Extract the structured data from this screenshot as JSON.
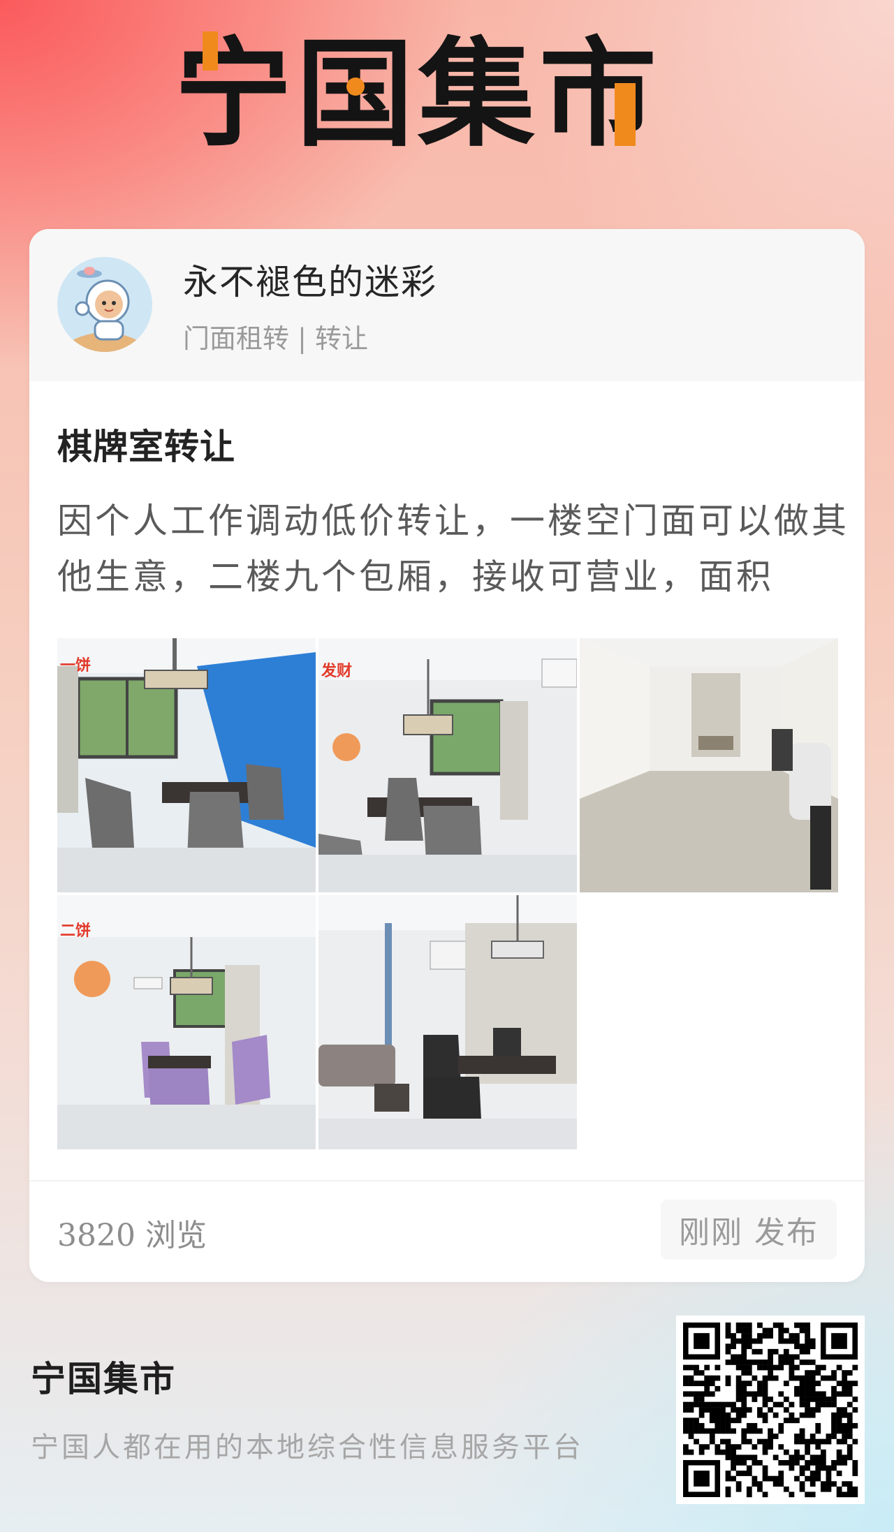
{
  "logo": {
    "chars": [
      "宁",
      "国",
      "集",
      "市"
    ],
    "text_color": "#141414",
    "accent_color": "#f08a1d"
  },
  "post": {
    "author": {
      "name": "永不褪色的迷彩",
      "category": "门面租转 | 转让",
      "avatar_icon": "astronaut-avatar-icon"
    },
    "title": "棋牌室转让",
    "body": "因个人工作调动低价转让，一楼空门面可以做其他生意，二楼九个包厢，接收可营业，面积",
    "photos": [
      {
        "name": "room-photo-1",
        "overlay_text": "一饼"
      },
      {
        "name": "room-photo-2",
        "overlay_text": "发财"
      },
      {
        "name": "room-photo-3",
        "overlay_text": ""
      },
      {
        "name": "room-photo-4",
        "overlay_text": "二饼"
      },
      {
        "name": "room-photo-5",
        "overlay_text": ""
      }
    ],
    "views": "3820 浏览",
    "published": "刚刚 发布"
  },
  "footer": {
    "brand_name": "宁国集市",
    "tagline": "宁国人都在用的本地综合性信息服务平台",
    "qr_icon": "qr-code-icon"
  }
}
